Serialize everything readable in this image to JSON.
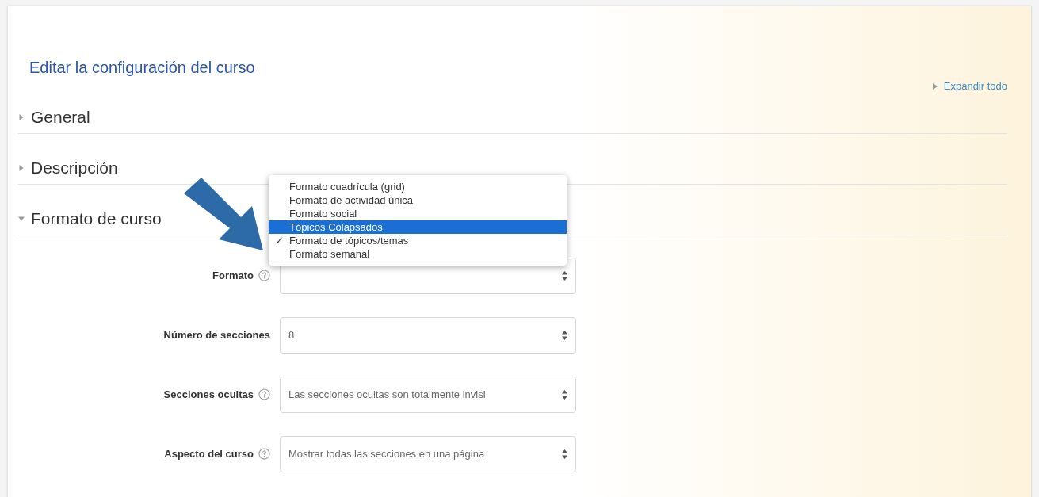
{
  "page_title": "Editar la configuración del curso",
  "expand_all": "Expandir todo",
  "check_mark": "✓",
  "sections": [
    {
      "title": "General",
      "expanded": false
    },
    {
      "title": "Descripción",
      "expanded": false
    },
    {
      "title": "Formato de curso",
      "expanded": true
    }
  ],
  "fields": [
    {
      "label": "Formato",
      "help": true,
      "options": [
        {
          "label": "Formato cuadrícula (grid)",
          "selected": false,
          "checked": false
        },
        {
          "label": "Formato de actividad única",
          "selected": false,
          "checked": false
        },
        {
          "label": "Formato social",
          "selected": false,
          "checked": false
        },
        {
          "label": "Tópicos Colapsados",
          "selected": true,
          "checked": false
        },
        {
          "label": "Formato de tópicos/temas",
          "selected": false,
          "checked": true
        },
        {
          "label": "Formato semanal",
          "selected": false,
          "checked": false
        }
      ]
    },
    {
      "label": "Número de secciones",
      "help": false,
      "value": "8"
    },
    {
      "label": "Secciones ocultas",
      "help": true,
      "value": "Las secciones ocultas son totalmente invisi"
    },
    {
      "label": "Aspecto del curso",
      "help": true,
      "value": "Mostrar todas las secciones en una página"
    }
  ]
}
